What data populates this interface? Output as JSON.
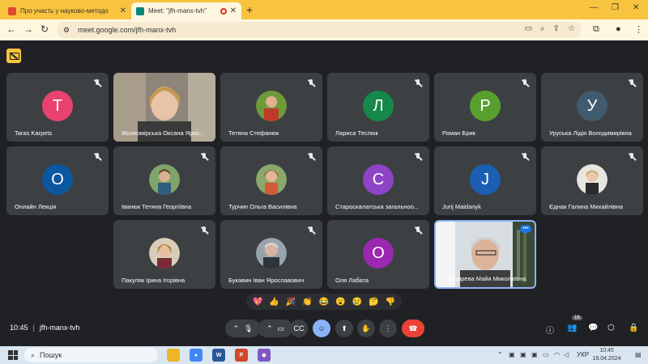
{
  "browser": {
    "tabs": [
      {
        "title": "Про участь у науково-методо",
        "active": false
      },
      {
        "title": "Meet: \"jfh-manx-tvh\"",
        "active": true
      }
    ],
    "url": "meet.google.com/jfh-manx-tvh",
    "accent": "#f8c33f"
  },
  "participants": [
    {
      "name": "Taras Karpets",
      "initial": "T",
      "color": "#e8436f",
      "muted": true
    },
    {
      "name": "Жизномірська Оксана Ярос...",
      "initial": "",
      "color": "",
      "muted": false,
      "video": true
    },
    {
      "name": "Тетяна Стефанюк",
      "initial": "",
      "color": "",
      "muted": true
    },
    {
      "name": "Лариса Теслюк",
      "initial": "Л",
      "color": "#15884a",
      "muted": true
    },
    {
      "name": "Роман Брик",
      "initial": "Р",
      "color": "#58a02e",
      "muted": true
    },
    {
      "name": "Уруська Лідія Володимирівна",
      "initial": "У",
      "color": "#405a6e",
      "muted": true
    },
    {
      "name": "Онлайн Лекція",
      "initial": "О",
      "color": "#0b57a0",
      "muted": true
    },
    {
      "name": "Іванюк Тетяна Георгіївна",
      "initial": "",
      "color": "",
      "muted": true
    },
    {
      "name": "Турчин Ольга Василівна",
      "initial": "",
      "color": "",
      "muted": true
    },
    {
      "name": "Староскалатська загальноо...",
      "initial": "С",
      "color": "#8e44c6",
      "muted": true
    },
    {
      "name": "Jurij Maidanyk",
      "initial": "J",
      "color": "#1a5fb4",
      "muted": true
    },
    {
      "name": "Єднак Галина Михайлівна",
      "initial": "",
      "color": "",
      "muted": true
    },
    {
      "name": "Пакуляк Ірина Ігорівна",
      "initial": "",
      "color": "",
      "muted": true
    },
    {
      "name": "Букавин Іван Ярославович",
      "initial": "",
      "color": "",
      "muted": true
    },
    {
      "name": "Оля Лабата",
      "initial": "О",
      "color": "#9c27b0",
      "muted": true
    },
    {
      "name": "Кондирева Майя Миколаївна",
      "initial": "",
      "color": "",
      "muted": false,
      "video": true,
      "self": true
    }
  ],
  "reactions": [
    "💖",
    "👍",
    "🎉",
    "👏",
    "😂",
    "😮",
    "😢",
    "🤔",
    "👎"
  ],
  "meeting": {
    "time": "10:45",
    "code": "jfh-manx-tvh",
    "participant_count": "16",
    "end_color": "#ea4335"
  },
  "taskbar": {
    "search_label": "Пошук",
    "lang": "УКР",
    "time": "10:45",
    "date": "19.04.2024"
  }
}
